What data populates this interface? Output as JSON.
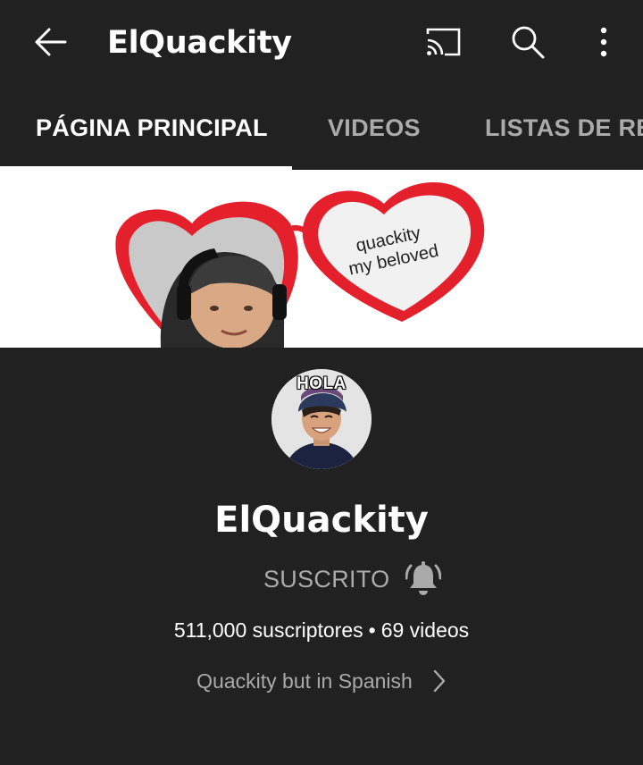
{
  "header": {
    "title": "ElQuackity",
    "back_icon": "arrow-left-icon",
    "cast_icon": "cast-icon",
    "search_icon": "search-icon",
    "more_icon": "more-vertical-icon"
  },
  "tabs": [
    {
      "label": "PÁGINA PRINCIPAL",
      "selected": true
    },
    {
      "label": "VIDEOS",
      "selected": false
    },
    {
      "label": "LISTAS DE REPRODUCCIÓN",
      "selected": false
    }
  ],
  "banner": {
    "caption_line1": "quackity",
    "caption_line2": "my beloved"
  },
  "channel": {
    "avatar_caption": "HOLA",
    "name": "ElQuackity",
    "subscribe_label": "SUSCRITO",
    "bell_icon": "notification-bell-icon",
    "subscribers": "511,000 suscriptores",
    "separator": "•",
    "videos": "69 videos",
    "description": "Quackity but in Spanish"
  },
  "colors": {
    "background": "#212121",
    "text_primary": "#ffffff",
    "text_secondary": "#aaaaaa",
    "heart_red": "#e3202b"
  }
}
